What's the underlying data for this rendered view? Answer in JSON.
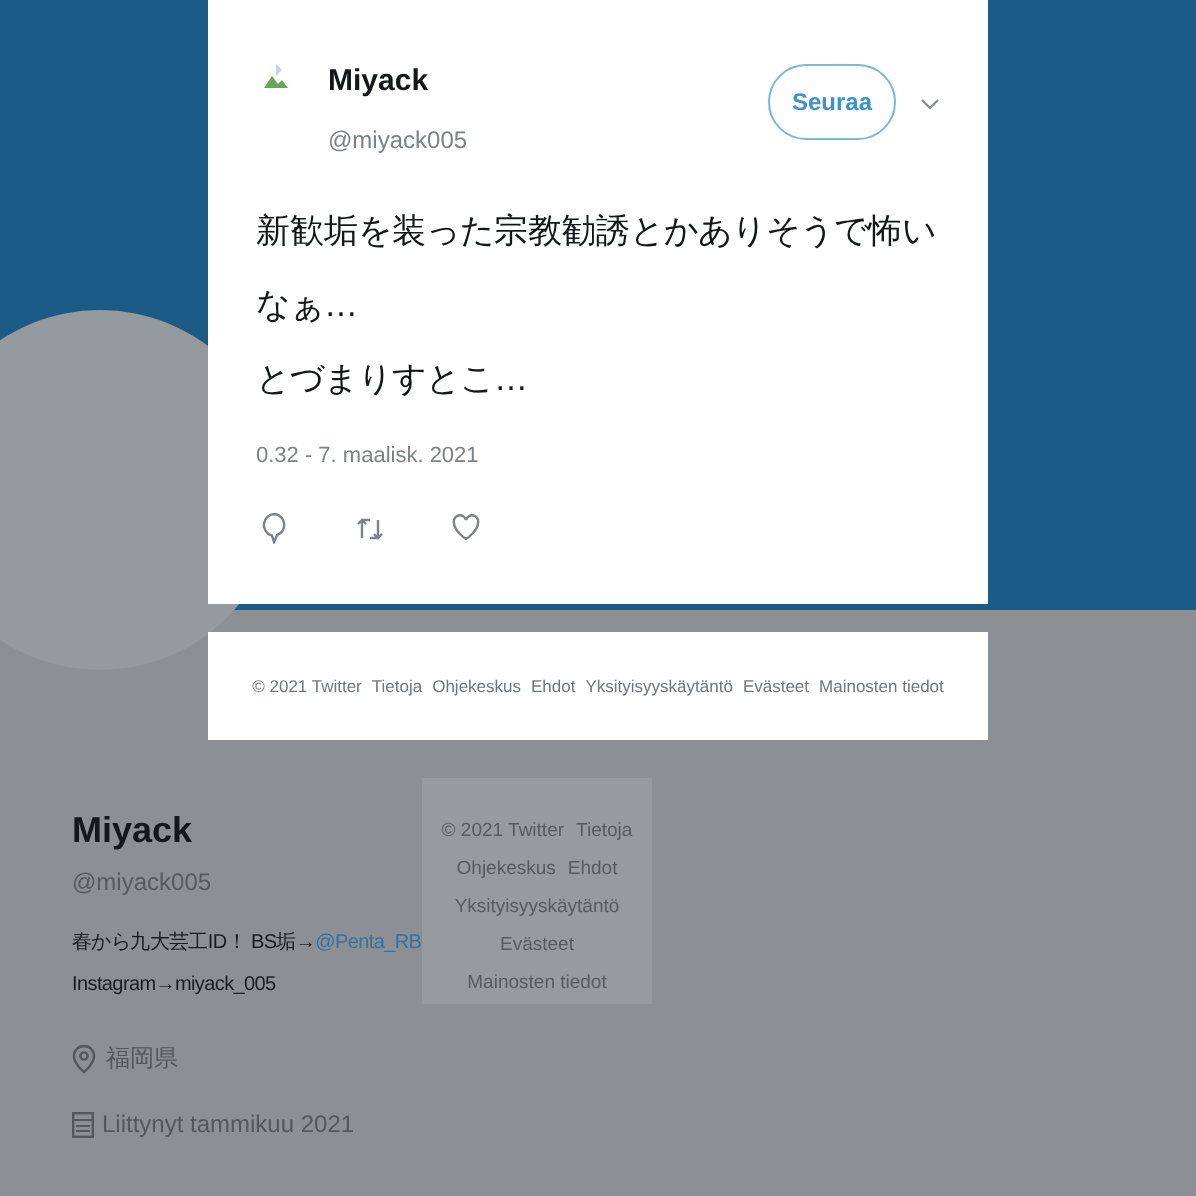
{
  "tweet_modal": {
    "author": {
      "name": "Miyack",
      "handle": "@miyack005"
    },
    "follow_button": "Seuraa",
    "text": "新歓垢を装った宗教勧誘とかありそうで怖いなぁ…\nとづまりすとこ…",
    "timestamp": "0.32 - 7. maalisk. 2021"
  },
  "modal_footer": {
    "links": [
      "© 2021 Twitter",
      "Tietoja",
      "Ohjekeskus",
      "Ehdot",
      "Yksityisyyskäytäntö",
      "Evästeet",
      "Mainosten tiedot"
    ]
  },
  "profile": {
    "name": "Miyack",
    "handle": "@miyack005",
    "bio_lines": [
      {
        "text": "春から九大芸工ID！ BS垢→",
        "link": "@Penta_RB"
      },
      {
        "text": "Instagram→miyack_005"
      }
    ],
    "location": "福岡県",
    "joined": "Liittynyt tammikuu 2021"
  },
  "sidebar_footer": {
    "links": [
      "© 2021 Twitter",
      "Tietoja",
      "Ohjekeskus",
      "Ehdot",
      "Yksityisyyskäytäntö",
      "Evästeet",
      "Mainosten tiedot"
    ]
  }
}
